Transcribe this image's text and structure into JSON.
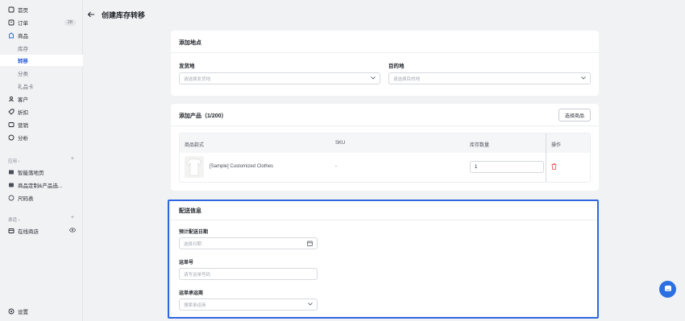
{
  "sidebar": {
    "items": [
      {
        "label": "首页",
        "icon": "home-icon"
      },
      {
        "label": "订单",
        "icon": "orders-icon",
        "badge": "28"
      },
      {
        "label": "商品",
        "icon": "product-icon"
      },
      {
        "label": "库存"
      },
      {
        "label": "转移"
      },
      {
        "label": "分类"
      },
      {
        "label": "礼品卡"
      },
      {
        "label": "客户",
        "icon": "customer-icon"
      },
      {
        "label": "折扣",
        "icon": "discount-icon"
      },
      {
        "label": "营销",
        "icon": "marketing-icon"
      },
      {
        "label": "分析",
        "icon": "analytics-icon"
      }
    ],
    "apps_label": "应用 ›",
    "apps": [
      {
        "label": "智能落地页"
      },
      {
        "label": "商品定制&产品选..."
      },
      {
        "label": "尺码表"
      }
    ],
    "channels_label": "渠道 ›",
    "channels": [
      {
        "label": "在线商店"
      }
    ],
    "settings_label": "设置"
  },
  "header": {
    "title": "创建库存转移"
  },
  "location_card": {
    "title": "添加地点",
    "origin_label": "发货地",
    "origin_placeholder": "请选择发货地",
    "destination_label": "目的地",
    "destination_placeholder": "请选择目的地"
  },
  "products_card": {
    "title": "添加产品（1/200）",
    "select_button": "选择商品",
    "columns": [
      "商品款式",
      "SKU",
      "库存数量",
      "操作"
    ],
    "rows": [
      {
        "name": "[Sample] Customized Clothes",
        "sku": "-",
        "quantity": "1"
      }
    ]
  },
  "shipping_card": {
    "title": "配送信息",
    "date_label": "预计配送日期",
    "date_placeholder": "选择日期",
    "tracking_label": "运单号",
    "tracking_placeholder": "请写运单号码",
    "carrier_label": "运单承运商",
    "carrier_placeholder": "搜索承运商"
  },
  "colors": {
    "accent": "#2b5fd9",
    "highlight": "#2f66e0",
    "delete": "#e5484d"
  }
}
